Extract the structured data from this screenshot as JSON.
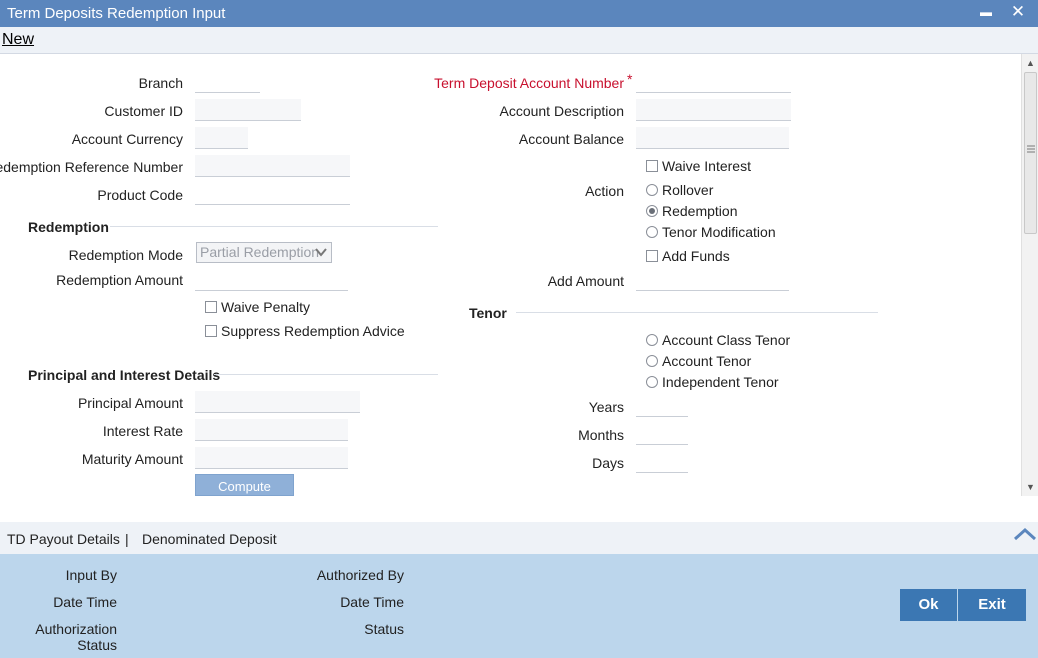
{
  "window": {
    "title": "Term Deposits Redemption Input",
    "minimize_glyph": "▬",
    "close_glyph": "✕"
  },
  "menu": {
    "new_label": "New"
  },
  "form": {
    "branch_label": "Branch",
    "customer_id_label": "Customer ID",
    "account_currency_label": "Account Currency",
    "redemption_ref_label": "Redemption Reference Number",
    "product_code_label": "Product Code",
    "td_account_label": "Term Deposit Account Number",
    "required_mark": "*",
    "account_description_label": "Account Description",
    "account_balance_label": "Account Balance",
    "waive_interest_label": "Waive Interest",
    "action_label": "Action",
    "action_options": [
      "Rollover",
      "Redemption",
      "Tenor Modification"
    ],
    "action_selected": "Redemption",
    "add_funds_label": "Add Funds",
    "add_amount_label": "Add Amount"
  },
  "redemption": {
    "section_title": "Redemption",
    "mode_label": "Redemption Mode",
    "mode_value": "Partial Redemption",
    "amount_label": "Redemption Amount",
    "waive_penalty_label": "Waive Penalty",
    "suppress_advice_label": "Suppress Redemption Advice"
  },
  "principal": {
    "section_title": "Principal and Interest Details",
    "principal_label": "Principal Amount",
    "interest_label": "Interest Rate",
    "maturity_label": "Maturity Amount",
    "compute_label": "Compute"
  },
  "tenor": {
    "section_title": "Tenor",
    "options": [
      "Account Class Tenor",
      "Account Tenor",
      "Independent Tenor"
    ],
    "years_label": "Years",
    "months_label": "Months",
    "days_label": "Days"
  },
  "tabs": {
    "payout": "TD Payout Details",
    "separator": "|",
    "denominated": "Denominated Deposit"
  },
  "footer": {
    "input_by": "Input By",
    "date_time_1": "Date Time",
    "auth_status_1": "Authorization",
    "auth_status_2": "Status",
    "authorized_by": "Authorized By",
    "date_time_2": "Date Time",
    "status": "Status",
    "ok_label": "Ok",
    "exit_label": "Exit"
  },
  "colors": {
    "titlebar": "#5b86bd",
    "footer": "#bcd6ec",
    "button": "#3b77b3",
    "required": "#c8102e"
  }
}
